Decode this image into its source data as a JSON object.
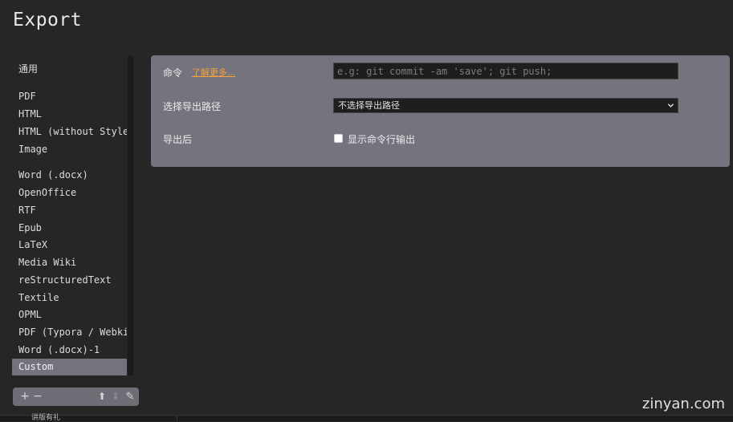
{
  "window": {
    "title": "Export"
  },
  "sidebar": {
    "items": [
      {
        "label": "通用",
        "selected": false
      },
      {
        "label": "PDF",
        "selected": false
      },
      {
        "label": "HTML",
        "selected": false
      },
      {
        "label": "HTML (without Styles)",
        "selected": false
      },
      {
        "label": "Image",
        "selected": false
      },
      {
        "label": "Word (.docx)",
        "selected": false
      },
      {
        "label": "OpenOffice",
        "selected": false
      },
      {
        "label": "RTF",
        "selected": false
      },
      {
        "label": "Epub",
        "selected": false
      },
      {
        "label": "LaTeX",
        "selected": false
      },
      {
        "label": "Media Wiki",
        "selected": false
      },
      {
        "label": "reStructuredText",
        "selected": false
      },
      {
        "label": "Textile",
        "selected": false
      },
      {
        "label": "OPML",
        "selected": false
      },
      {
        "label": "PDF (Typora / Webkit)",
        "selected": false
      },
      {
        "label": "Word (.docx)-1",
        "selected": false
      },
      {
        "label": "Custom",
        "selected": true
      }
    ],
    "toolbar": {
      "add": "+",
      "remove": "−",
      "move_up": "⬆",
      "move_down": "⬇",
      "edit": "✎"
    }
  },
  "panel": {
    "command": {
      "label": "命令",
      "learn_more": "了解更多...",
      "placeholder": "e.g: git commit -am 'save'; git push;",
      "value": ""
    },
    "path": {
      "label": "选择导出路径",
      "selected": "不选择导出路径"
    },
    "after_export": {
      "label": "导出后",
      "checkbox_label": "显示命令行输出",
      "checked": false
    }
  },
  "watermark": "zinyan.com",
  "taskbar": {
    "text": "讲版有礼"
  }
}
